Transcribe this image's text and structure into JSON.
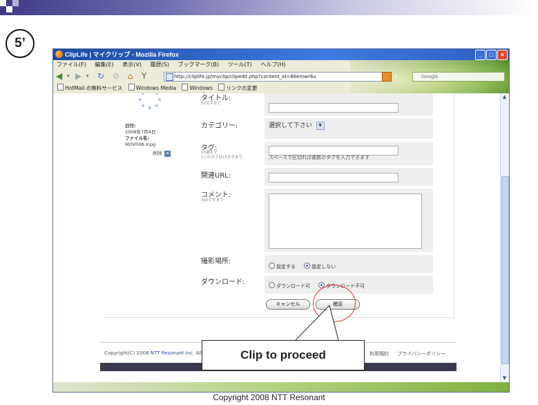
{
  "slide": {
    "step_label": "5’",
    "callout": "Clip to proceed",
    "copyright": "Copyright 2008 NTT Resonant"
  },
  "browser": {
    "title": "ClipLife | マイクリップ - Mozilla Firefox",
    "menu": [
      "ファイル(F)",
      "編集(E)",
      "表示(V)",
      "履歴(S)",
      "ブックマーク(B)",
      "ツール(T)",
      "ヘルプ(H)"
    ],
    "url": "http://cliplife.jp/myclip/clipedit.php?content_id=86emwr6u",
    "search_placeholder": "Google",
    "bookmarks": [
      "HotMail の無料サービス",
      "Windows Media",
      "Windows",
      "リンクの変更"
    ],
    "status": ""
  },
  "clip": {
    "date_label": "日付:",
    "date_value": "2008年7月4日",
    "file_label": "ファイル名:",
    "file_value": "MOV008.mpg",
    "delete_label": "削除"
  },
  "form": {
    "title_label": "タイトル:",
    "title_hint": "50文字まで",
    "category_label": "カテゴリー:",
    "category_value": "選択して下さい",
    "tags_label": "タグ:",
    "tags_hint1": "10個まで",
    "tags_hint2": "1つのタグは15文字まで",
    "tags_instruction": "スペースで区切れば複数のタグを入力できます",
    "url_label": "関連URL:",
    "comment_label": "コメント:",
    "comment_hint": "400文字まで",
    "location_label": "撮影場所:",
    "location_options": [
      "設定する",
      "設定しない"
    ],
    "download_label": "ダウンロード:",
    "download_options": [
      "ダウンロード可",
      "ダウンロード不可"
    ],
    "cancel_label": "キャンセル",
    "confirm_label": "確認"
  },
  "footer": {
    "copyright_prefix": "Copyright(C) 2008 ",
    "company": "NTT Resonant Inc.",
    "suffix": " All",
    "links": [
      "利用規約",
      "プライバシーポリシー"
    ]
  }
}
